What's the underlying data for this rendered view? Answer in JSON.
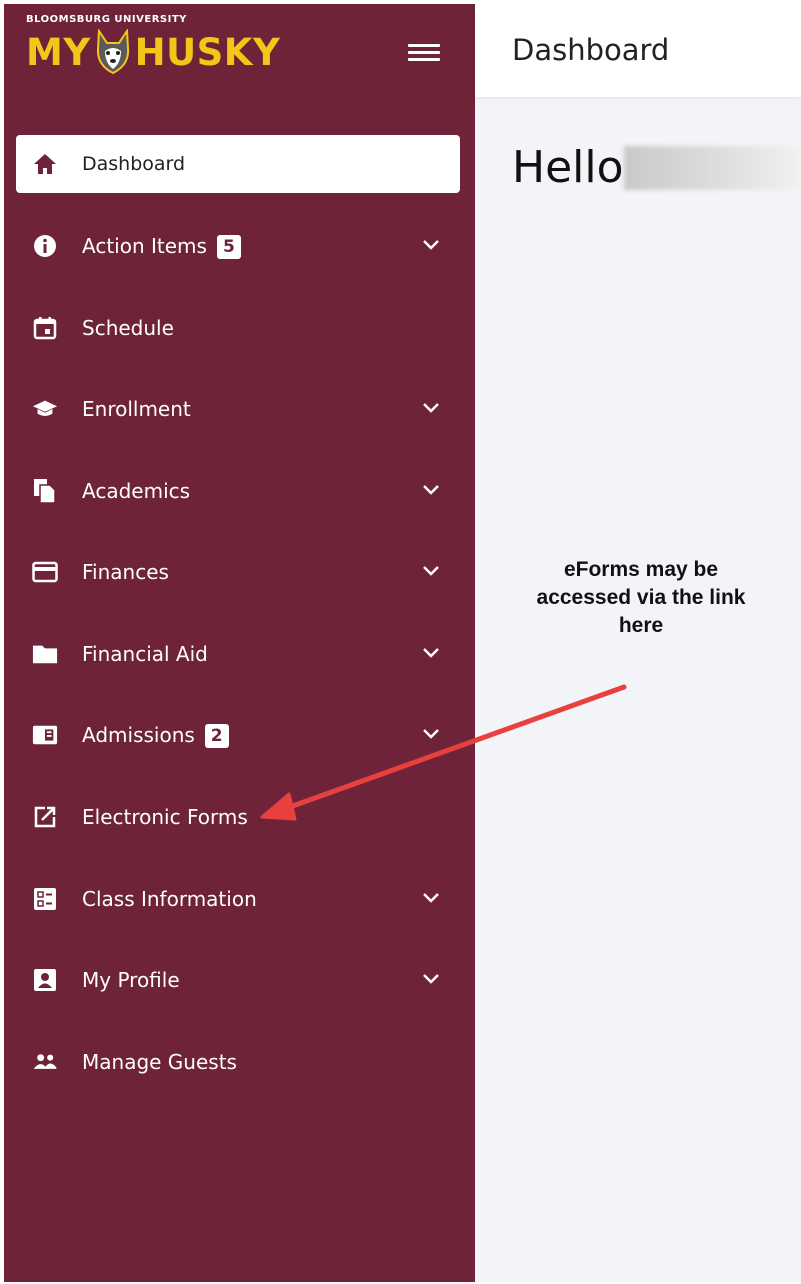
{
  "header": {
    "university": "BLOOMSBURG UNIVERSITY",
    "app_name_part1": "MY",
    "app_name_part2": "HUSKY",
    "page_title": "Dashboard",
    "brand_color": "#6e2339",
    "accent_color": "#f5c51a"
  },
  "sidebar": {
    "items": [
      {
        "label": "Dashboard",
        "icon": "home-icon",
        "active": true
      },
      {
        "label": "Action Items",
        "icon": "info-icon",
        "badge": "5",
        "expandable": true
      },
      {
        "label": "Schedule",
        "icon": "calendar-icon"
      },
      {
        "label": "Enrollment",
        "icon": "graduation-cap-icon",
        "expandable": true
      },
      {
        "label": "Academics",
        "icon": "documents-icon",
        "expandable": true
      },
      {
        "label": "Finances",
        "icon": "credit-card-icon",
        "expandable": true
      },
      {
        "label": "Financial Aid",
        "icon": "folder-icon",
        "expandable": true
      },
      {
        "label": "Admissions",
        "icon": "newspaper-icon",
        "badge": "2",
        "expandable": true
      },
      {
        "label": "Electronic Forms",
        "icon": "external-edit-icon"
      },
      {
        "label": "Class Information",
        "icon": "list-box-icon",
        "expandable": true
      },
      {
        "label": "My Profile",
        "icon": "profile-card-icon",
        "expandable": true
      },
      {
        "label": "Manage Guests",
        "icon": "people-icon"
      }
    ]
  },
  "main": {
    "greeting": "Hello",
    "annotation": "eForms may be accessed via the link here",
    "annotation_color": "#e8413d"
  }
}
